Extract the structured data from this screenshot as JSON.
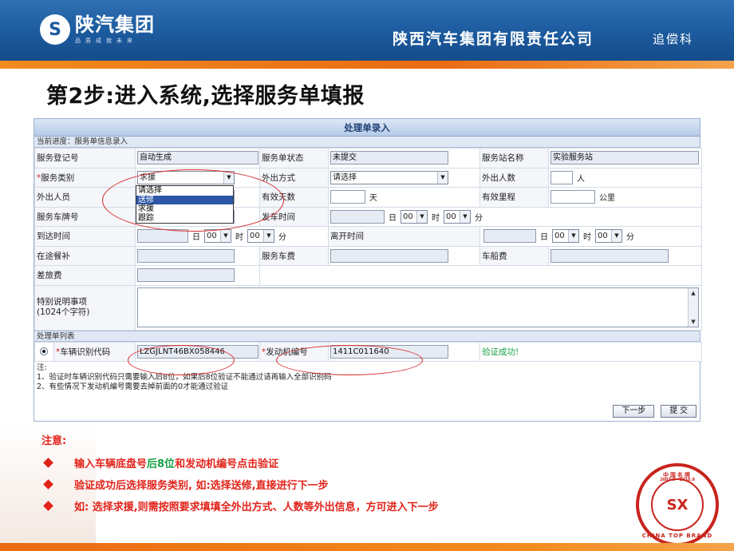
{
  "header": {
    "logo_mark": "S",
    "logo_text": "陕汽集团",
    "logo_slogan": "品质成就未来",
    "company": "陕西汽车集团有限责任公司",
    "dept": "追偿科"
  },
  "step_title": "第2步:进入系统,选择服务单填报",
  "form": {
    "title": "处理单录入",
    "progress": "当前进度：服务单信息录入",
    "row1": {
      "l1": "服务登记号",
      "v1": "自动生成",
      "l2": "服务单状态",
      "v2": "未提交",
      "l3": "服务站名称",
      "v3": "实验服务站"
    },
    "row2": {
      "l1": "服务类别",
      "v1": "求援",
      "l2": "外出方式",
      "v2": "请选择",
      "l3": "外出人数",
      "u3": "人"
    },
    "row3": {
      "l1": "外出人员",
      "l2": "有效天数",
      "u2": "天",
      "l3": "有效里程",
      "u3": "公里"
    },
    "row4": {
      "l1": "服务车牌号",
      "l2": "发车时间",
      "day": "日",
      "hour_val": "00",
      "hour": "时",
      "min_val": "00",
      "min": "分"
    },
    "row5": {
      "l1": "到达时间",
      "day": "日",
      "hour_val": "00",
      "hour": "时",
      "min_val": "00",
      "min": "分",
      "l2": "离开时间",
      "day2": "日",
      "hour_val2": "00",
      "hour2": "时",
      "min_val2": "00",
      "min2": "分"
    },
    "row6": {
      "l1": "在途餐补",
      "l2": "服务车费",
      "l3": "车船费"
    },
    "row7": {
      "l1": "差旅费"
    },
    "row8": {
      "l1": "特别说明事项",
      "l1b": "(1024个字符)",
      "scroll_up": "▲",
      "scroll_down": "▼"
    },
    "dropdown_options": [
      "请选择",
      "送修",
      "求援",
      "跟踪"
    ],
    "dropdown_highlight_index": 1,
    "select_arrow": "▼",
    "section2": "处理单列表",
    "vin_label": "车辆识别代码",
    "vin_value": "LZGJLNT46BX058446",
    "engine_label": "发动机编号",
    "engine_value": "1411C011640",
    "verify_status": "验证成功!",
    "notes_title": "注:",
    "notes": [
      "1、验证时车辆识别代码只需要输入后8位，如果后8位验证不能通过请再输入全部识别码",
      "2、有些情况下发动机编号需要去掉前面的0才能通过验证"
    ],
    "btn_next": "下一步",
    "btn_submit": "提 交"
  },
  "notice": {
    "title": "注意:",
    "item1_a": "输入车辆底盘号",
    "item1_b": "后8位",
    "item1_c": "和发动机编号点击验证",
    "item2": "验证成功后选择服务类别, 如:选择送修,直接进行下一步",
    "item3": "如: 选择求援,则需按照要求填填全外出方式、人数等外出信息，方可进入下一步"
  },
  "badge": {
    "top_text": "中国名牌",
    "year_text": "2007.9—2010.9",
    "center": "SX",
    "bottom_text": "CHINA TOP BRAND"
  },
  "colors": {
    "brand_blue": "#1c5a9e",
    "accent_orange": "#f28a1e",
    "alert_red": "#e2231a",
    "ok_green": "#17a043"
  }
}
